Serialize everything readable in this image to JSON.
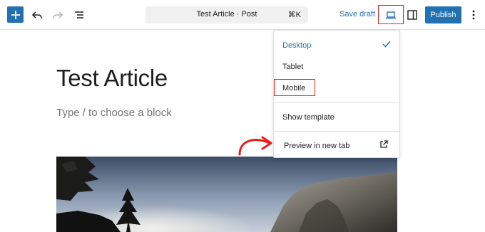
{
  "toolbar": {
    "document_title": "Test Article · Post",
    "shortcut": "⌘K",
    "save_draft_label": "Save draft",
    "publish_label": "Publish"
  },
  "editor": {
    "post_title": "Test Article",
    "placeholder": "Type / to choose a block"
  },
  "preview_menu": {
    "items": [
      {
        "label": "Desktop",
        "selected": true
      },
      {
        "label": "Tablet",
        "selected": false
      },
      {
        "label": "Mobile",
        "selected": false
      }
    ],
    "show_template_label": "Show template",
    "preview_new_tab_label": "Preview in new tab"
  },
  "icons": {
    "add": "plus-icon",
    "undo": "undo-icon",
    "redo": "redo-icon",
    "list_view": "list-view-icon",
    "device_preview": "desktop-icon",
    "settings": "sidebar-icon",
    "more": "more-vertical-icon",
    "check": "check-icon",
    "external": "external-link-icon"
  },
  "colors": {
    "accent": "#2271b1",
    "highlight": "#e51f1f"
  }
}
